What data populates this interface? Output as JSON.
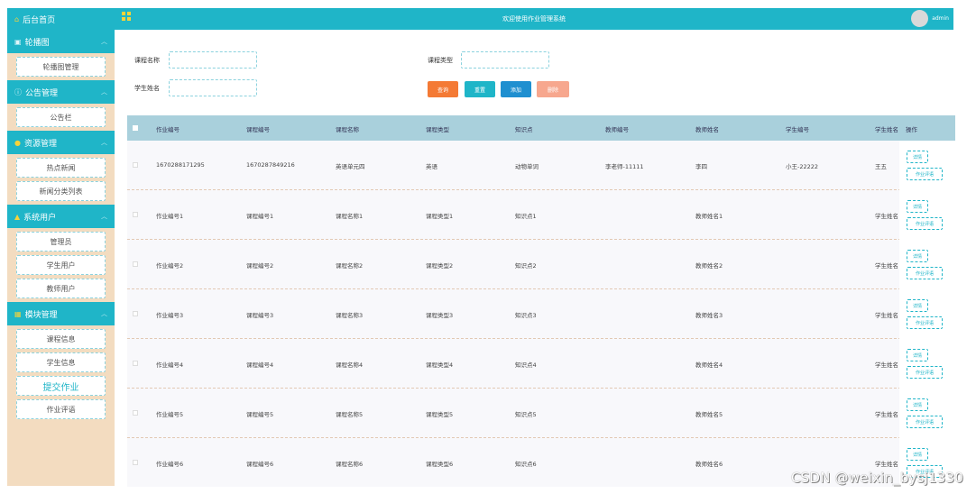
{
  "sidebar": {
    "home": "后台首页",
    "groups": [
      {
        "title": "轮播图",
        "icon": "image-icon",
        "items": [
          "轮播图管理"
        ]
      },
      {
        "title": "公告管理",
        "icon": "info-icon",
        "items": [
          "公告栏"
        ]
      },
      {
        "title": "资源管理",
        "icon": "location-icon",
        "items": [
          "热点新闻",
          "新闻分类列表"
        ]
      },
      {
        "title": "系统用户",
        "icon": "user-icon",
        "items": [
          "管理员",
          "学生用户",
          "教师用户"
        ]
      },
      {
        "title": "模块管理",
        "icon": "grid-icon",
        "items": [
          "课程信息",
          "学生信息",
          "提交作业",
          "作业评语"
        ]
      }
    ],
    "active_item": "提交作业"
  },
  "header": {
    "title": "欢迎使用作业管理系统",
    "user": "admin"
  },
  "search": {
    "course_name_label": "课程名称",
    "course_type_label": "课程类型",
    "student_name_label": "学生姓名",
    "course_name_value": "",
    "course_type_value": "",
    "student_name_value": ""
  },
  "actions": {
    "query": "查询",
    "reset": "重置",
    "add": "添加",
    "delete": "删除"
  },
  "table": {
    "headers": [
      "作业编号",
      "课程编号",
      "课程名称",
      "课程类型",
      "知识点",
      "教师编号",
      "教师姓名",
      "学生编号",
      "学生姓名",
      "操作"
    ],
    "rows": [
      [
        "1670288171295",
        "1670287849216",
        "英语单元四",
        "英语",
        "动物单词",
        "李老师-11111",
        "李四",
        "小王-22222",
        "王五"
      ],
      [
        "作业编号1",
        "课程编号1",
        "课程名称1",
        "课程类型1",
        "知识点1",
        "",
        "教师姓名1",
        "",
        "学生姓名"
      ],
      [
        "作业编号2",
        "课程编号2",
        "课程名称2",
        "课程类型2",
        "知识点2",
        "",
        "教师姓名2",
        "",
        "学生姓名"
      ],
      [
        "作业编号3",
        "课程编号3",
        "课程名称3",
        "课程类型3",
        "知识点3",
        "",
        "教师姓名3",
        "",
        "学生姓名"
      ],
      [
        "作业编号4",
        "课程编号4",
        "课程名称4",
        "课程类型4",
        "知识点4",
        "",
        "教师姓名4",
        "",
        "学生姓名"
      ],
      [
        "作业编号5",
        "课程编号5",
        "课程名称5",
        "课程类型5",
        "知识点5",
        "",
        "教师姓名5",
        "",
        "学生姓名"
      ],
      [
        "作业编号6",
        "课程编号6",
        "课程名称6",
        "课程类型6",
        "知识点6",
        "",
        "教师姓名6",
        "",
        "学生姓名"
      ]
    ],
    "row_actions": {
      "detail": "详情",
      "review": "作业评语"
    }
  },
  "watermark": "CSDN @weixin_bysj1330",
  "colors": {
    "primary": "#1fb5c8",
    "query": "#f47a35",
    "reset": "#1fb5c8",
    "add": "#1f8fd0",
    "delete": "#f7a78e",
    "sidebar_bg": "#f3dcc0",
    "table_header": "#a9d0dc"
  }
}
